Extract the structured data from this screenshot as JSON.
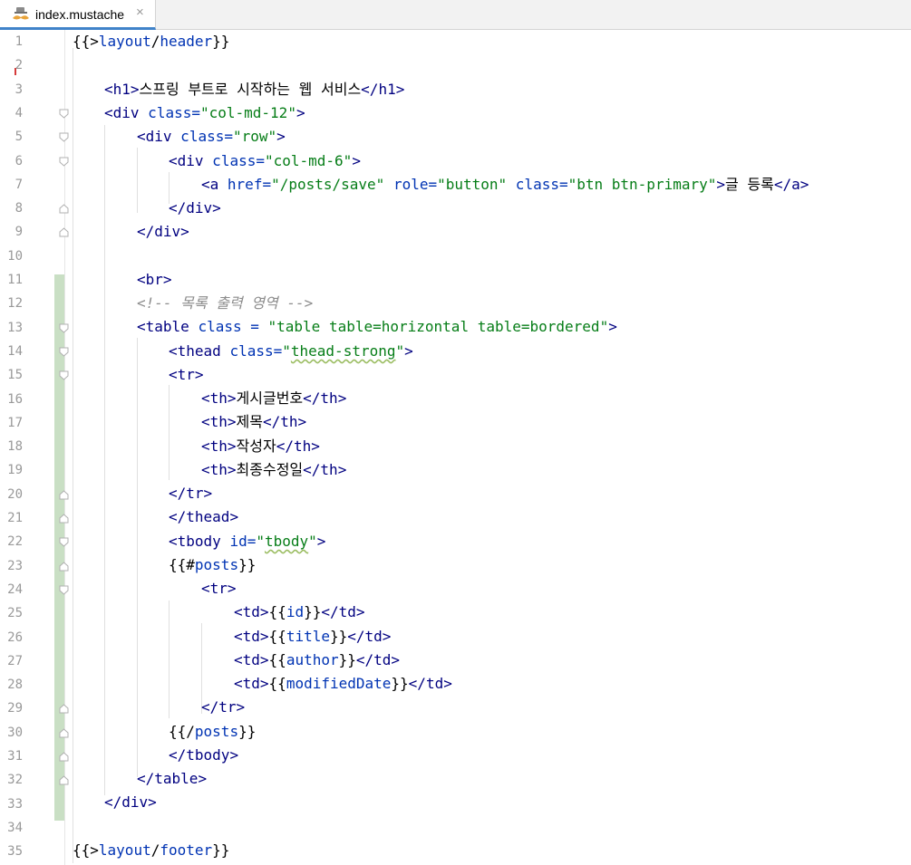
{
  "tab": {
    "file_name": "index.mustache",
    "close": "×"
  },
  "line_numbers": [
    "1",
    "2",
    "3",
    "4",
    "5",
    "6",
    "7",
    "8",
    "9",
    "10",
    "11",
    "12",
    "13",
    "14",
    "15",
    "16",
    "17",
    "18",
    "19",
    "20",
    "21",
    "22",
    "23",
    "24",
    "25",
    "26",
    "27",
    "28",
    "29",
    "30",
    "31",
    "32",
    "33",
    "34",
    "35"
  ],
  "code": {
    "l1": [
      "{{>",
      "layout",
      "/",
      "header",
      "}}"
    ],
    "l3": [
      "<",
      "h1",
      ">",
      "스프링 부트로 시작하는 웹 서비스",
      "</",
      "h1",
      ">"
    ],
    "l4": [
      "<",
      "div",
      " class=",
      "\"col-md-12\"",
      ">"
    ],
    "l5": [
      "<",
      "div",
      " class=",
      "\"row\"",
      ">"
    ],
    "l6": [
      "<",
      "div",
      " class=",
      "\"col-md-6\"",
      ">"
    ],
    "l7": [
      "<",
      "a",
      " href=",
      "\"/posts/save\"",
      " role=",
      "\"button\"",
      " class=",
      "\"btn btn-primary\"",
      ">",
      "글 등록",
      "</",
      "a",
      ">"
    ],
    "l8": [
      "</",
      "div",
      ">"
    ],
    "l9": [
      "</",
      "div",
      ">"
    ],
    "l11": [
      "<",
      "br",
      ">"
    ],
    "l12": "<!-- 목록 출력 영역 -->",
    "l13": [
      "<",
      "table",
      " class = ",
      "\"table table=horizontal table=bordered\"",
      ">"
    ],
    "l14": [
      "<",
      "thead",
      " class=",
      "\"",
      "thead-strong",
      "\"",
      ">"
    ],
    "l15": [
      "<",
      "tr",
      ">"
    ],
    "l16": [
      "<",
      "th",
      ">",
      "게시글번호",
      "</",
      "th",
      ">"
    ],
    "l17": [
      "<",
      "th",
      ">",
      "제목",
      "</",
      "th",
      ">"
    ],
    "l18": [
      "<",
      "th",
      ">",
      "작성자",
      "</",
      "th",
      ">"
    ],
    "l19": [
      "<",
      "th",
      ">",
      "최종수정일",
      "</",
      "th",
      ">"
    ],
    "l20": [
      "</",
      "tr",
      ">"
    ],
    "l21": [
      "</",
      "thead",
      ">"
    ],
    "l22": [
      "<",
      "tbody",
      " id=",
      "\"",
      "tbody",
      "\"",
      ">"
    ],
    "l23": [
      "{{#",
      "posts",
      "}}"
    ],
    "l24": [
      "<",
      "tr",
      ">"
    ],
    "l25": [
      "<",
      "td",
      ">",
      "{{",
      "id",
      "}}",
      "</",
      "td",
      ">"
    ],
    "l26": [
      "<",
      "td",
      ">",
      "{{",
      "title",
      "}}",
      "</",
      "td",
      ">"
    ],
    "l27": [
      "<",
      "td",
      ">",
      "{{",
      "author",
      "}}",
      "</",
      "td",
      ">"
    ],
    "l28": [
      "<",
      "td",
      ">",
      "{{",
      "modifiedDate",
      "}}",
      "</",
      "td",
      ">"
    ],
    "l29": [
      "</",
      "tr",
      ">"
    ],
    "l30": [
      "{{/",
      "posts",
      "}}"
    ],
    "l31": [
      "</",
      "tbody",
      ">"
    ],
    "l32": [
      "</",
      "table",
      ">"
    ],
    "l33": [
      "</",
      "div",
      ">"
    ],
    "l35": [
      "{{>",
      "layout",
      "/",
      "footer",
      "}}"
    ]
  },
  "colors": {
    "tag": "#000080",
    "attribute": "#0033b3",
    "string": "#067d17",
    "comment": "#8c8c8c",
    "changed_line_marker": "#c9dfc4",
    "tab_accent": "#4083c9"
  }
}
